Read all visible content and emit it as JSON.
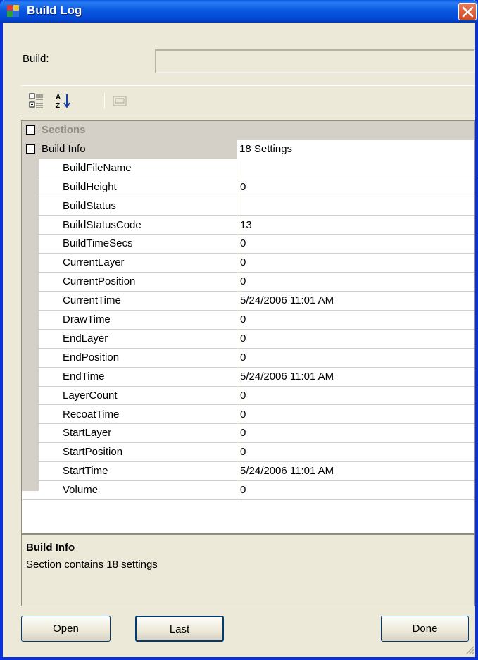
{
  "window": {
    "title": "Build Log"
  },
  "build": {
    "label": "Build:",
    "value": ""
  },
  "toolbar": {
    "icons": [
      "categorized-icon",
      "alphabetical-icon",
      "property-pages-icon"
    ]
  },
  "grid": {
    "sections_label": "Sections",
    "category": {
      "name": "Build Info",
      "value": "18 Settings"
    },
    "properties": [
      {
        "name": "BuildFileName",
        "value": ""
      },
      {
        "name": "BuildHeight",
        "value": "0"
      },
      {
        "name": "BuildStatus",
        "value": ""
      },
      {
        "name": "BuildStatusCode",
        "value": "13"
      },
      {
        "name": "BuildTimeSecs",
        "value": "0"
      },
      {
        "name": "CurrentLayer",
        "value": "0"
      },
      {
        "name": "CurrentPosition",
        "value": "0"
      },
      {
        "name": "CurrentTime",
        "value": "5/24/2006 11:01 AM"
      },
      {
        "name": "DrawTime",
        "value": "0"
      },
      {
        "name": "EndLayer",
        "value": "0"
      },
      {
        "name": "EndPosition",
        "value": "0"
      },
      {
        "name": "EndTime",
        "value": "5/24/2006 11:01 AM"
      },
      {
        "name": "LayerCount",
        "value": "0"
      },
      {
        "name": "RecoatTime",
        "value": "0"
      },
      {
        "name": "StartLayer",
        "value": "0"
      },
      {
        "name": "StartPosition",
        "value": "0"
      },
      {
        "name": "StartTime",
        "value": "5/24/2006 11:01 AM"
      },
      {
        "name": "Volume",
        "value": "0"
      }
    ]
  },
  "description": {
    "title": "Build Info",
    "text": "Section contains 18 settings"
  },
  "buttons": {
    "open": "Open",
    "last": "Last",
    "done": "Done"
  }
}
